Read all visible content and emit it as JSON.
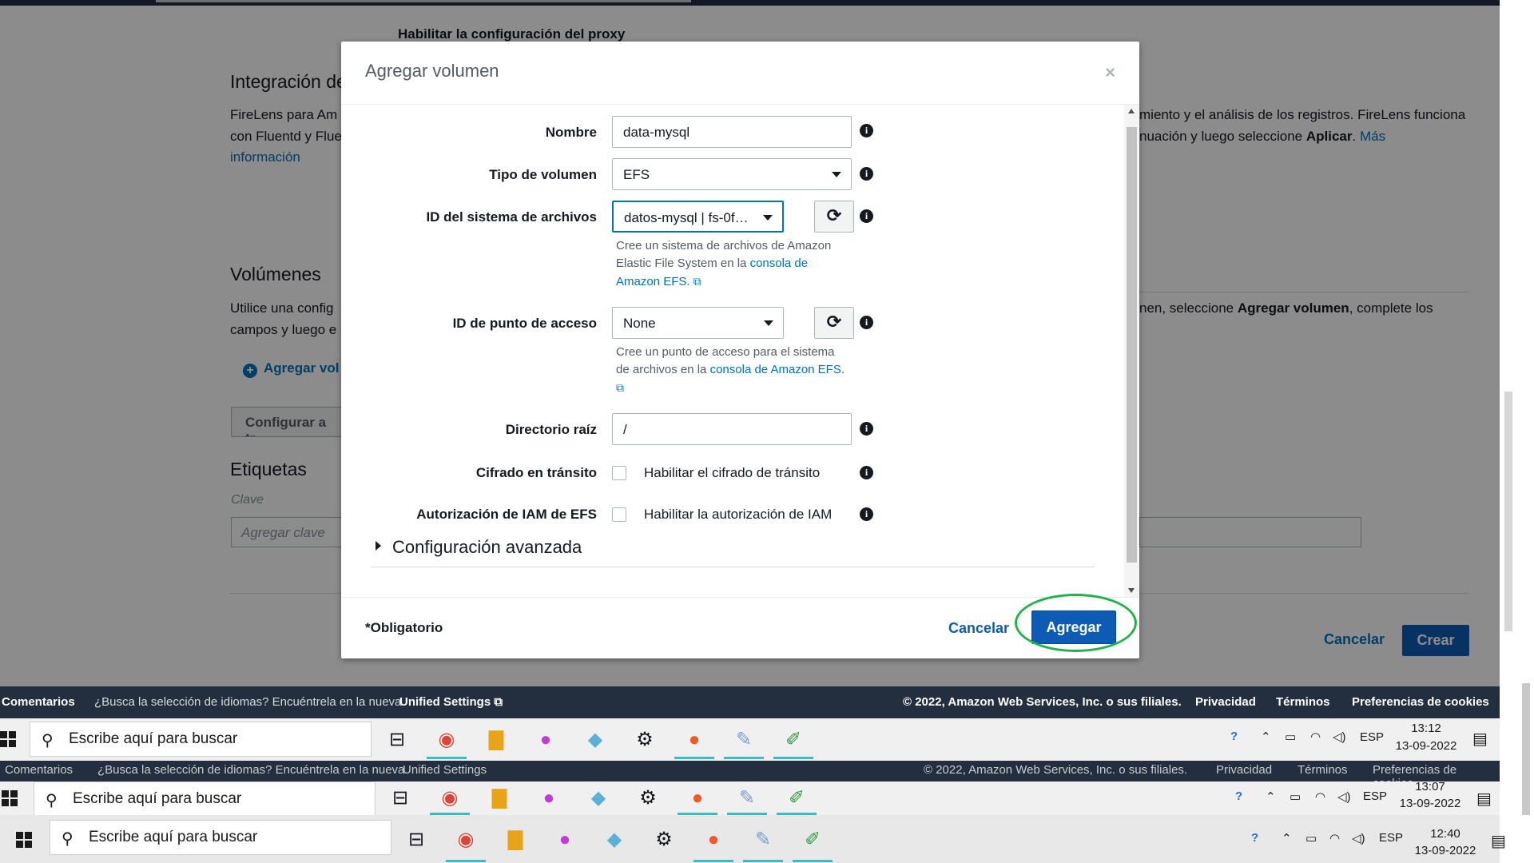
{
  "background_page": {
    "proxy_label": "Habilitar la configuración del proxy",
    "firelens": {
      "heading": "Integración de",
      "text_left_1": "FireLens para Am",
      "text_left_2": "con Fluentd y Flue",
      "link_left": "información",
      "text_right_1": "miento y el análisis de los registros. FireLens funciona",
      "text_right_2a": "nuación y luego seleccione ",
      "text_right_2b": "Aplicar",
      "text_right_2c": ". ",
      "link_right": "Más"
    },
    "volumes": {
      "heading": "Volúmenes",
      "text_left_1": "Utilice una config",
      "text_left_2": "campos y luego e",
      "text_right_a": "nen, seleccione ",
      "text_right_b": "Agregar volumen",
      "text_right_c": ", complete los",
      "add_volume_link": "Agregar vol",
      "config_button": "Configurar a tr"
    },
    "tags": {
      "heading": "Etiquetas",
      "key_label": "Clave",
      "key_placeholder": "Agregar clave"
    },
    "cancel": "Cancelar",
    "create": "Crear"
  },
  "modal": {
    "title": "Agregar volumen",
    "close": "×",
    "fields": {
      "name": {
        "label": "Nombre",
        "value": "data-mysql"
      },
      "volume_type": {
        "label": "Tipo de volumen",
        "value": "EFS"
      },
      "fs_id": {
        "label": "ID del sistema de archivos",
        "value": "datos-mysql | fs-0f…",
        "help_a": "Cree un sistema de archivos de Amazon Elastic File System en la ",
        "help_link": "consola de Amazon EFS."
      },
      "access_point": {
        "label": "ID de punto de acceso",
        "value": "None",
        "help_a": "Cree un punto de acceso para el sistema de archivos en la ",
        "help_link": "consola de Amazon EFS."
      },
      "root_dir": {
        "label": "Directorio raíz",
        "value": "/"
      },
      "transit_encryption": {
        "label": "Cifrado en tránsito",
        "checkbox_label": "Habilitar el cifrado de tránsito"
      },
      "iam_auth": {
        "label": "Autorización de IAM de EFS",
        "checkbox_label": "Habilitar la autorización de IAM"
      }
    },
    "advanced": "Configuración avanzada",
    "required": "*Obligatorio",
    "cancel": "Cancelar",
    "add": "Agregar"
  },
  "footer": {
    "feedback": "Comentarios",
    "lang_prompt": "¿Busca la selección de idiomas? Encuéntrela en la nueva",
    "unified_settings": "Unified Settings",
    "copyright": "© 2022, Amazon Web Services, Inc. o sus filiales.",
    "privacy": "Privacidad",
    "terms": "Términos",
    "cookies": "Preferencias de cookies"
  },
  "taskbars": [
    {
      "search": "Escribe aquí para buscar",
      "lang": "ESP",
      "time": "13:12",
      "date": "13-09-2022"
    },
    {
      "search": "Escribe aquí para buscar",
      "lang": "ESP",
      "time": "13:07",
      "date": "13-09-2022"
    },
    {
      "search": "Escribe aquí para buscar",
      "lang": "ESP",
      "time": "12:40",
      "date": "13-09-2022"
    }
  ],
  "icons": [
    "windows-logo",
    "search-icon",
    "task-view-icon",
    "chrome-icon",
    "file-explorer-icon",
    "paint3d-icon",
    "app-icon",
    "settings-icon",
    "browser-icon",
    "paint-icon",
    "notes-icon",
    "help-icon",
    "chevron-up-icon",
    "battery-icon",
    "wifi-icon",
    "volume-icon",
    "notification-icon"
  ],
  "colors": {
    "accent": "#0d5bb5",
    "link": "#0073bb",
    "highlight": "#22b14c",
    "footer": "#232f3e"
  }
}
